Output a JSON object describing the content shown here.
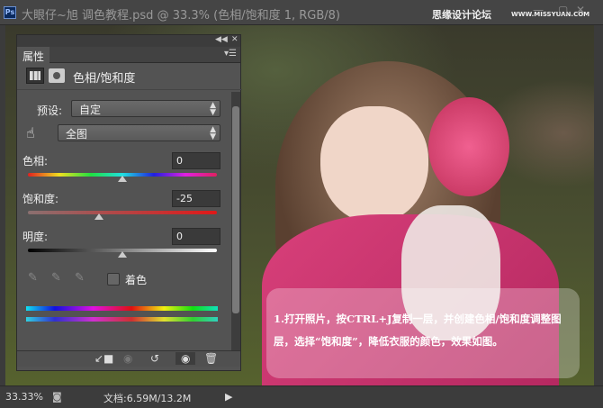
{
  "window": {
    "title": "大眼仔~旭 调色教程.psd @ 33.3% (色相/饱和度 1, RGB/8)",
    "watermark": "思缘设计论坛",
    "watermark_url": "WWW.MISSYUAN.COM",
    "ps_logo": "Ps"
  },
  "panel": {
    "tab": "属性",
    "header": "色相/饱和度",
    "preset_label": "预设:",
    "preset_value": "自定",
    "channel_value": "全图",
    "hue_label": "色相:",
    "hue_value": "0",
    "hue_fraction": 0.5,
    "sat_label": "饱和度:",
    "sat_value": "-25",
    "sat_fraction": 0.375,
    "light_label": "明度:",
    "light_value": "0",
    "light_fraction": 0.5,
    "colorize_label": "着色",
    "colorize_checked": false
  },
  "caption": "1.打开照片，按CTRL+J复制一层，并创建色相/饱和度调整图层，选择“饱和度”，降低衣服的颜色，效果如图。",
  "status": {
    "zoom": "33.33%",
    "doc": "文档:6.59M/13.2M"
  }
}
